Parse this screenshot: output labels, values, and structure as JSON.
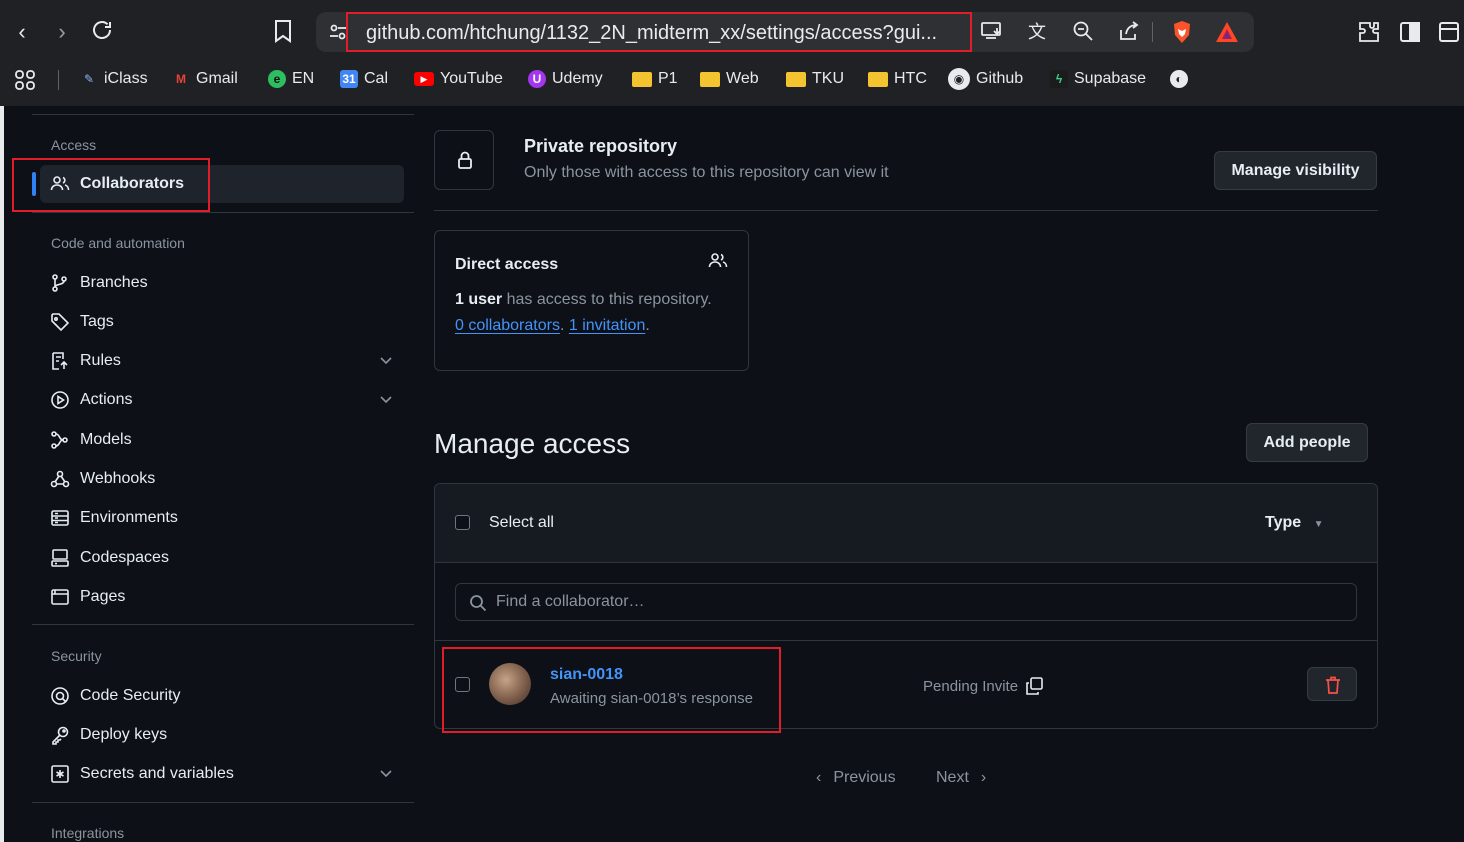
{
  "browser": {
    "url": "github.com/htchung/1132_2N_midterm_xx/settings/access?gui...",
    "bookmarks": [
      {
        "label": "iClass",
        "icon": "iclass-icon"
      },
      {
        "label": "Gmail",
        "icon": "gmail-icon"
      },
      {
        "label": "EN",
        "icon": "evernote-icon"
      },
      {
        "label": "Cal",
        "icon": "calendar-icon"
      },
      {
        "label": "YouTube",
        "icon": "youtube-icon"
      },
      {
        "label": "Udemy",
        "icon": "udemy-icon"
      },
      {
        "label": "P1",
        "icon": "folder-icon"
      },
      {
        "label": "Web",
        "icon": "folder-icon"
      },
      {
        "label": "TKU",
        "icon": "folder-icon"
      },
      {
        "label": "HTC",
        "icon": "folder-icon"
      },
      {
        "label": "Github",
        "icon": "github-icon"
      },
      {
        "label": "Supabase",
        "icon": "supabase-icon"
      }
    ]
  },
  "sidebar": {
    "sections": {
      "access": "Access",
      "code_automation": "Code and automation",
      "security": "Security",
      "integrations": "Integrations"
    },
    "items": {
      "collaborators": "Collaborators",
      "branches": "Branches",
      "tags": "Tags",
      "rules": "Rules",
      "actions": "Actions",
      "models": "Models",
      "webhooks": "Webhooks",
      "environments": "Environments",
      "codespaces": "Codespaces",
      "pages": "Pages",
      "code_security": "Code Security",
      "deploy_keys": "Deploy keys",
      "secrets_variables": "Secrets and variables"
    }
  },
  "visibility": {
    "title": "Private repository",
    "description": "Only those with access to this repository can view it",
    "button": "Manage visibility"
  },
  "direct_access": {
    "title": "Direct access",
    "count": "1 user",
    "suffix": " has access to this repository.",
    "collaborators_link": "0 collaborators",
    "separator": ". ",
    "invitation_link": "1 invitation",
    "end": "."
  },
  "manage": {
    "title": "Manage access",
    "add_button": "Add people",
    "select_all": "Select all",
    "type": "Type",
    "search_placeholder": "Find a collaborator…",
    "rows": [
      {
        "username": "sian-0018",
        "status": "Awaiting sian-0018’s response",
        "role": "Pending Invite"
      }
    ]
  },
  "pagination": {
    "previous": "Previous",
    "next": "Next"
  },
  "colors": {
    "accent": "#2f81f7",
    "link": "#4493f8",
    "danger": "#f85149",
    "highlight": "#e11d2a"
  }
}
